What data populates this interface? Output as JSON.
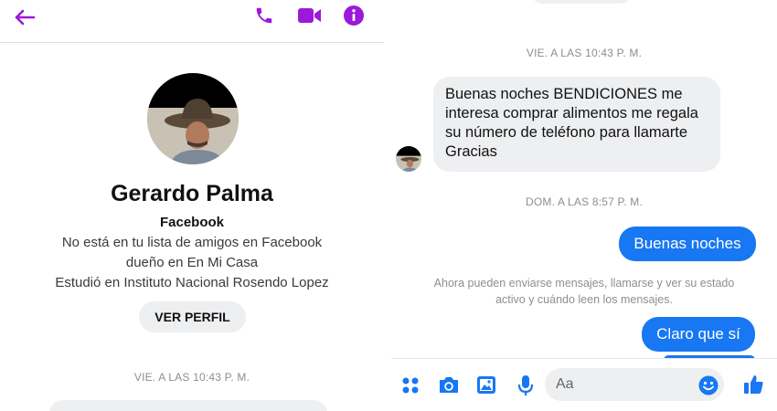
{
  "profile": {
    "name": "Gerardo Palma",
    "source": "Facebook",
    "friend_status": "No está en tu lista de amigos en Facebook",
    "owner": "dueño en En Mi Casa",
    "education": "Estudió en Instituto Nacional Rosendo Lopez",
    "view_profile_label": "VER PERFIL"
  },
  "left_timestamp": "VIE. A LAS 10:43 P. M.",
  "conversation": {
    "timestamp_1": "VIE. A LAS 10:43 P. M.",
    "incoming_message": "Buenas noches BENDICIONES me interesa comprar alimentos me regala su número de teléfono para llamarte Gracias",
    "timestamp_2": "DOM. A LAS 8:57 P. M.",
    "outgoing_1": "Buenas noches",
    "system_message": "Ahora pueden enviarse mensajes, llamarse y ver su estado activo y cuándo leen los mensajes.",
    "outgoing_2": "Claro que sí"
  },
  "composer": {
    "placeholder": "Aa"
  },
  "icons": {
    "back": "arrow-left-icon",
    "call": "phone-icon",
    "video": "video-camera-icon",
    "info": "info-icon",
    "more": "four-dots-icon",
    "camera": "camera-icon",
    "gallery": "image-icon",
    "mic": "microphone-icon",
    "emoji": "smiley-icon",
    "like": "thumbs-up-icon"
  },
  "colors": {
    "header_accent": "#9b19d9",
    "messenger_blue": "#1877f2",
    "bubble_gray": "#eeeff1",
    "timestamp_gray": "#8e8e8e"
  }
}
